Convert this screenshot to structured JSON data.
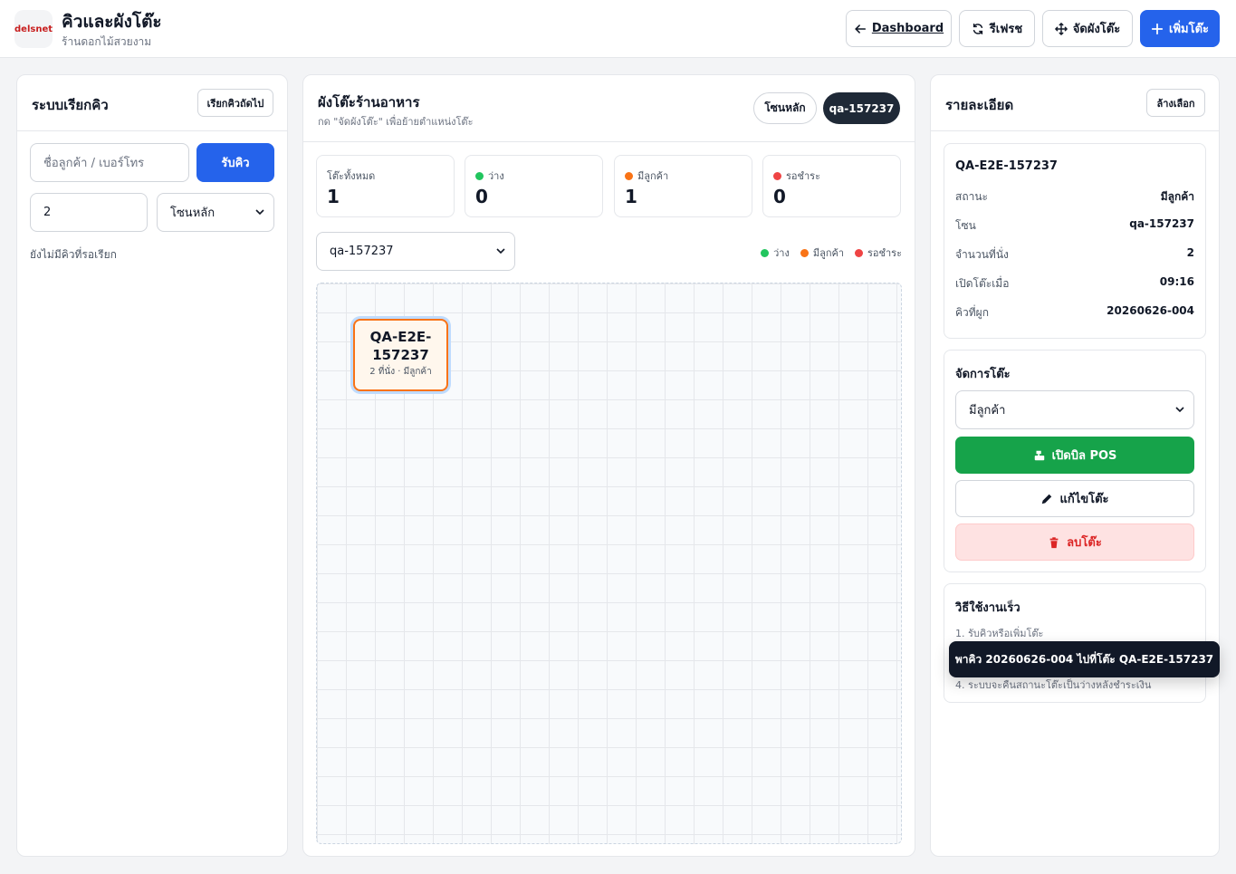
{
  "header": {
    "logo_text": "delsnet",
    "title": "คิวและผังโต๊ะ",
    "subtitle": "ร้านดอกไม้สวยงาม",
    "buttons": {
      "dashboard": "Dashboard",
      "refresh": "รีเฟรช",
      "arrange": "จัดผังโต๊ะ",
      "add_table": "เพิ่มโต๊ะ"
    }
  },
  "queue": {
    "title": "ระบบเรียกคิว",
    "call_next": "เรียกคิวถัดไป",
    "name_placeholder": "ชื่อลูกค้า / เบอร์โทร",
    "take_queue": "รับคิว",
    "party_size": "2",
    "zone_selected": "โซนหลัก",
    "empty_text": "ยังไม่มีคิวที่รอเรียก"
  },
  "floor": {
    "title": "ผังโต๊ะร้านอาหาร",
    "subtitle": "กด \"จัดผังโต๊ะ\" เพื่อย้ายตำแหน่งโต๊ะ",
    "zone_tabs": [
      "โซนหลัก",
      "qa-157237"
    ],
    "active_zone_tab": "qa-157237",
    "stats": {
      "total": {
        "label": "โต๊ะทั้งหมด",
        "value": "1"
      },
      "free": {
        "label": "ว่าง",
        "value": "0",
        "color": "#22c55e"
      },
      "occupied": {
        "label": "มีลูกค้า",
        "value": "1",
        "color": "#f97316"
      },
      "awaiting_payment": {
        "label": "รอชำระ",
        "value": "0",
        "color": "#ef4444"
      }
    },
    "zone_select": "qa-157237",
    "legend": [
      {
        "label": "ว่าง",
        "color": "#22c55e"
      },
      {
        "label": "มีลูกค้า",
        "color": "#f97316"
      },
      {
        "label": "รอชำระ",
        "color": "#ef4444"
      }
    ],
    "tables": [
      {
        "name_line1": "QA-E2E-",
        "name_line2": "157237",
        "meta": "2 ที่นั่ง · มีลูกค้า"
      }
    ]
  },
  "details": {
    "title": "รายละเอียด",
    "clear": "ล้างเลือก",
    "table_name": "QA-E2E-157237",
    "rows": [
      {
        "k": "สถานะ",
        "v": "มีลูกค้า"
      },
      {
        "k": "โซน",
        "v": "qa-157237"
      },
      {
        "k": "จำนวนที่นั่ง",
        "v": "2"
      },
      {
        "k": "เปิดโต๊ะเมื่อ",
        "v": "09:16"
      },
      {
        "k": "คิวที่ผูก",
        "v": "20260626-004"
      }
    ],
    "manage_title": "จัดการโต๊ะ",
    "status_select": "มีลูกค้า",
    "open_pos": "เปิดบิล POS",
    "edit_table": "แก้ไขโต๊ะ",
    "delete_table": "ลบโต๊ะ",
    "quick_title": "วิธีใช้งานเร็ว",
    "steps": [
      "1. รับคิวหรือเพิ่มโต๊ะ",
      "4. ระบบจะคืนสถานะโต๊ะเป็นว่างหลังชำระเงิน"
    ]
  },
  "toast": "พาคิว 20260626-004 ไปที่โต๊ะ QA-E2E-157237"
}
